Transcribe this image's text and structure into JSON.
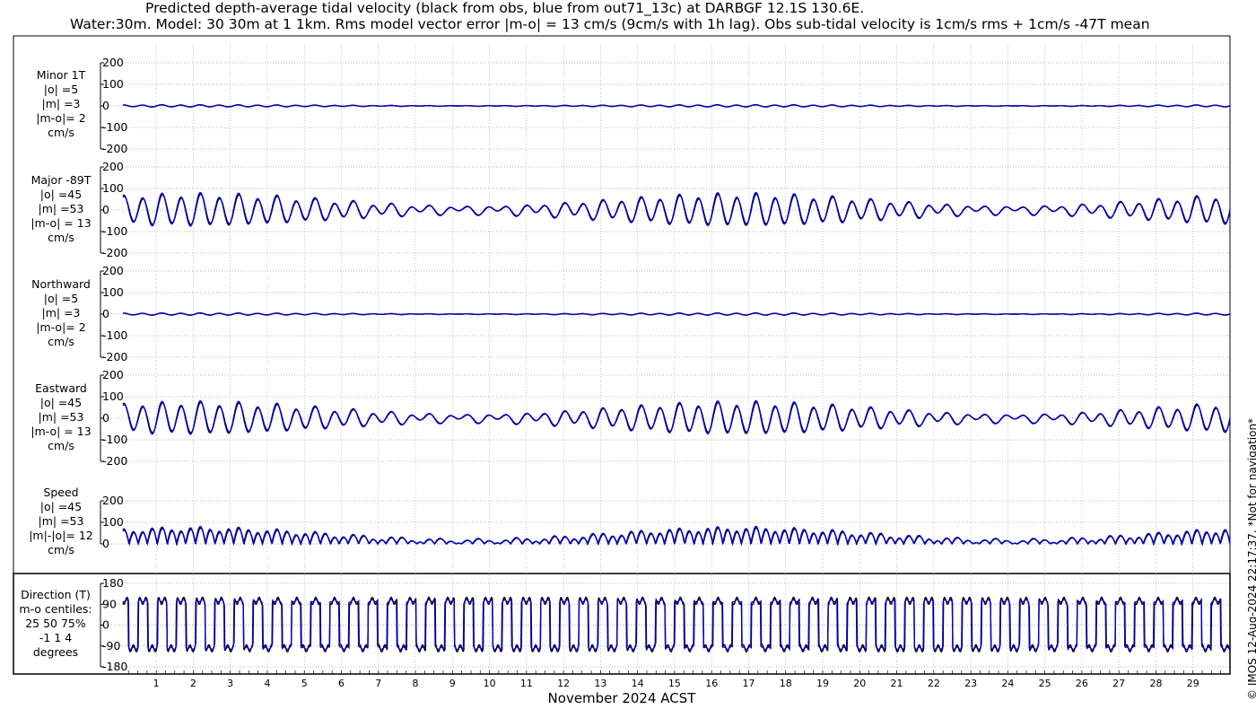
{
  "title": {
    "line1": "Predicted depth-average tidal velocity (black from obs, blue from out71_13c) at DARBGF 12.1S 130.6E.",
    "line2": "Water:30m. Model: 30 30m at 1 1km. Rms model vector error |m-o| = 13 cm/s (9cm/s with 1h lag). Obs sub-tidal velocity is 1cm/s rms + 1cm/s -47T mean"
  },
  "copyright": "© IMOS 12-Aug-2024 22:17:37. *Not for navigation*",
  "xlabel": "November 2024 ACST",
  "colors": {
    "obs": "#000000",
    "model": "#0000cc",
    "grid": "#a0a0a0"
  },
  "chart_data": {
    "type": "line",
    "x_ticks": [
      "1",
      "2",
      "3",
      "4",
      "5",
      "6",
      "7",
      "8",
      "9",
      "10",
      "11",
      "12",
      "13",
      "14",
      "15",
      "16",
      "17",
      "18",
      "19",
      "20",
      "21",
      "22",
      "23",
      "24",
      "25",
      "26",
      "27",
      "28",
      "29"
    ],
    "x_range_days": [
      0.1,
      30.0
    ],
    "series_legend": [
      "obs (black)",
      "model out71_13c (blue)"
    ],
    "panels": [
      {
        "key": "minor",
        "label": [
          "Minor 1T",
          "|o| =5",
          "|m| =3",
          "|m-o|= 2",
          "cm/s"
        ],
        "yticks": [
          "200",
          "100",
          "0",
          "-100",
          "-200"
        ],
        "ylim": [
          -200,
          200
        ],
        "amplitude_obs": 5,
        "amplitude_model": 3
      },
      {
        "key": "major",
        "label": [
          "Major -89T",
          "|o| =45",
          "|m| =53",
          "|m-o| = 13",
          "cm/s"
        ],
        "yticks": [
          "200",
          "100",
          "0",
          "-100",
          "-200"
        ],
        "ylim": [
          -200,
          200
        ],
        "amplitude_obs": 45,
        "amplitude_model": 53
      },
      {
        "key": "north",
        "label": [
          "Northward",
          "|o| =5",
          "|m| =3",
          "|m-o|= 2",
          "cm/s"
        ],
        "yticks": [
          "200",
          "100",
          "0",
          "-100",
          "-200"
        ],
        "ylim": [
          -200,
          200
        ],
        "amplitude_obs": 5,
        "amplitude_model": 3
      },
      {
        "key": "east",
        "label": [
          "Eastward",
          "|o| =45",
          "|m| =53",
          "|m-o| = 13",
          "cm/s"
        ],
        "yticks": [
          "200",
          "100",
          "0",
          "-100",
          "-200"
        ],
        "ylim": [
          -200,
          200
        ],
        "amplitude_obs": 45,
        "amplitude_model": 53
      },
      {
        "key": "speed",
        "label": [
          "Speed",
          "|o| =45",
          "|m| =53",
          "|m|-|o|= 12",
          "cm/s"
        ],
        "yticks": [
          "200",
          "100",
          "0"
        ],
        "ylim": [
          0,
          200
        ],
        "amplitude_obs": 45,
        "amplitude_model": 53
      },
      {
        "key": "direction",
        "label": [
          "Direction (T)",
          "m-o centiles:",
          "25  50  75%",
          "-1  1  4",
          "degrees"
        ],
        "yticks": [
          "180",
          "90",
          "0",
          "-90",
          "-180"
        ],
        "ylim": [
          -180,
          180
        ]
      }
    ]
  }
}
